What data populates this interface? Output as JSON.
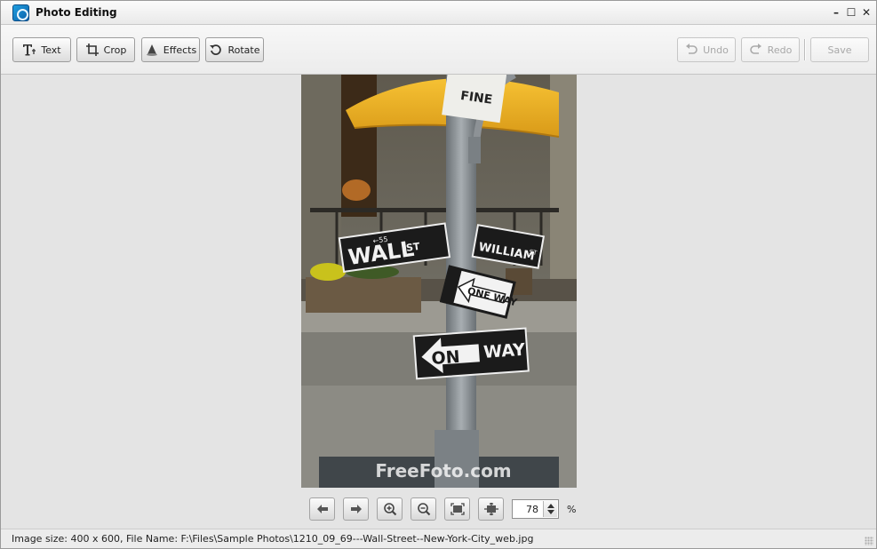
{
  "window": {
    "title": "Photo Editing",
    "controls": {
      "minimize": "–",
      "maximize": "☐",
      "close": "✕"
    }
  },
  "toolbar": {
    "left": [
      {
        "label": "Text",
        "icon": "text-icon"
      },
      {
        "label": "Crop",
        "icon": "crop-icon"
      },
      {
        "label": "Effects",
        "icon": "effects-icon"
      },
      {
        "label": "Rotate",
        "icon": "rotate-icon"
      }
    ],
    "undo_label": "Undo",
    "redo_label": "Redo",
    "save_label": "Save"
  },
  "photo": {
    "sign_wall": "WALL",
    "sign_wall_st": "ST",
    "sign_wall_num": "←55",
    "sign_william": "WILLIAM",
    "sign_william_st": "ST",
    "sign_oneway_1": "ONE WAY",
    "sign_oneway_2a": "ON",
    "sign_oneway_2b": "WAY",
    "sign_fine": "FINE",
    "watermark": "FreeFoto.com"
  },
  "zoom": {
    "value": "78",
    "unit": "%"
  },
  "status": {
    "text": "Image size: 400 x 600, File Name: F:\\Files\\Sample Photos\\1210_09_69---Wall-Street--New-York-City_web.jpg"
  },
  "colors": {
    "umbrella": "#f0b52c",
    "sign_black": "#1b1b1b",
    "sign_white": "#f2f2f2",
    "pole": "#8c9296"
  }
}
